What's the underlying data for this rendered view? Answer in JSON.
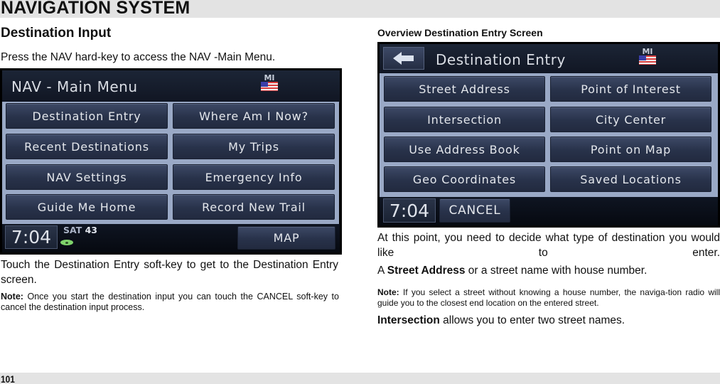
{
  "header": {
    "title": "NAVIGATION SYSTEM"
  },
  "footer": {
    "page_number": "101"
  },
  "left": {
    "heading": "Destination Input",
    "intro": "Press the NAV hard-key to access the NAV -Main Menu.",
    "screen": {
      "title": "NAV - Main Menu",
      "region": "MI",
      "buttons": [
        "Destination Entry",
        "Where Am I Now?",
        "Recent Destinations",
        "My Trips",
        "NAV Settings",
        "Emergency Info",
        "Guide Me Home",
        "Record New Trail"
      ],
      "clock": "7:04",
      "sat_label": "SAT",
      "sat_count": "43",
      "map_button": "MAP"
    },
    "body": "Touch the Destination Entry soft-key to get to the Destination Entry screen.",
    "note_label": "Note:",
    "note_text": " Once you start the destination input you can touch the CANCEL soft-key to cancel the destination input process."
  },
  "right": {
    "heading": "Overview Destination Entry Screen",
    "screen": {
      "title": "Destination Entry",
      "region": "MI",
      "buttons": [
        "Street Address",
        "Point of Interest",
        "Intersection",
        "City Center",
        "Use Address Book",
        "Point on Map",
        "Geo Coordinates",
        "Saved Locations"
      ],
      "clock": "7:04",
      "cancel_button": "CANCEL"
    },
    "body": "At this point, you need to decide what type of destination you would like to enter.",
    "street_prefix": "A ",
    "street_bold": "Street Address",
    "street_suffix": " or a street name with house number.",
    "note_label": "Note:",
    "note_text": " If you select a street without knowing a house number, the naviga-tion radio will guide you to the closest end location on the entered street.",
    "intersection_bold": "Intersection",
    "intersection_suffix": " allows you to enter two street names."
  }
}
